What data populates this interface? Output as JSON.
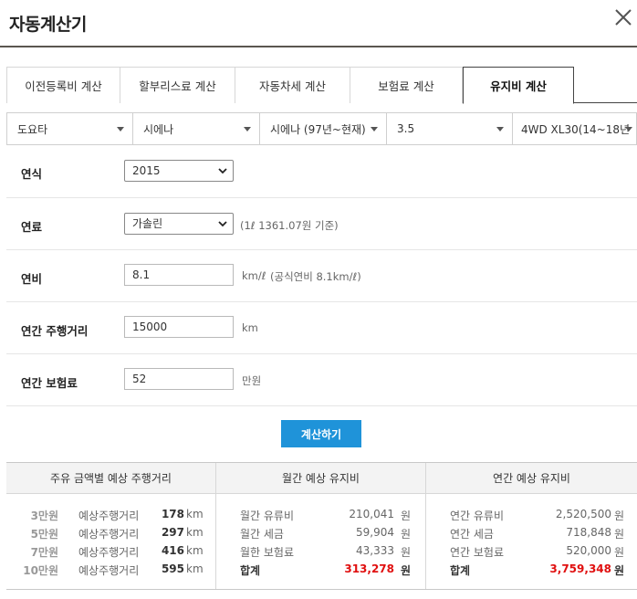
{
  "header": {
    "title": "자동계산기",
    "close_icon": "close-icon"
  },
  "tabs": [
    {
      "label": "이전등록비 계산",
      "active": false
    },
    {
      "label": "할부리스료 계산",
      "active": false
    },
    {
      "label": "자동차세 계산",
      "active": false
    },
    {
      "label": "보험료 계산",
      "active": false
    },
    {
      "label": "유지비 계산",
      "active": true
    }
  ],
  "selectors": [
    {
      "value": "도요타"
    },
    {
      "value": "시에나"
    },
    {
      "value": "시에나 (97년~현재)"
    },
    {
      "value": "3.5"
    },
    {
      "value": "4WD XL30(14~18년"
    }
  ],
  "form": {
    "year": {
      "label": "연식",
      "value": "2015"
    },
    "fuel": {
      "label": "연료",
      "value": "가솔린",
      "note": "(1ℓ 1361.07원 기준)"
    },
    "efficiency": {
      "label": "연비",
      "value": "8.1",
      "unit": "km/ℓ",
      "note": "(공식연비 8.1km/ℓ)"
    },
    "distance": {
      "label": "연간 주행거리",
      "value": "15000",
      "unit": "km"
    },
    "insurance": {
      "label": "연간 보험료",
      "value": "52",
      "unit": "만원"
    }
  },
  "calc_button": "계산하기",
  "results": {
    "col1": {
      "header": "주유 금액별 예상 주행거리",
      "rows": [
        {
          "amount": "3만원",
          "label": "예상주행거리",
          "value": "178",
          "unit": "km"
        },
        {
          "amount": "5만원",
          "label": "예상주행거리",
          "value": "297",
          "unit": "km"
        },
        {
          "amount": "7만원",
          "label": "예상주행거리",
          "value": "416",
          "unit": "km"
        },
        {
          "amount": "10만원",
          "label": "예상주행거리",
          "value": "595",
          "unit": "km"
        }
      ]
    },
    "col2": {
      "header": "월간 예상 유지비",
      "rows": [
        {
          "label": "월간 유류비",
          "value": "210,041",
          "unit": "원"
        },
        {
          "label": "월간 세금",
          "value": "59,904",
          "unit": "원"
        },
        {
          "label": "월한 보험료",
          "value": "43,333",
          "unit": "원"
        },
        {
          "label": "합계",
          "value": "313,278",
          "unit": "원"
        }
      ]
    },
    "col3": {
      "header": "연간 예상 유지비",
      "rows": [
        {
          "label": "연간 유류비",
          "value": "2,520,500",
          "unit": "원"
        },
        {
          "label": "연간 세금",
          "value": "718,848",
          "unit": "원"
        },
        {
          "label": "연간 보험료",
          "value": "520,000",
          "unit": "원"
        },
        {
          "label": "합계",
          "value": "3,759,348",
          "unit": "원"
        }
      ]
    }
  }
}
